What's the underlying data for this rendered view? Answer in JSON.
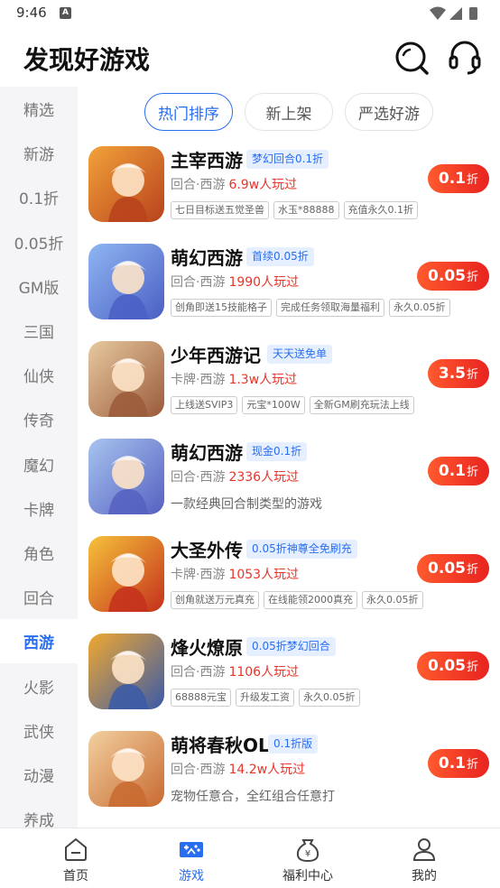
{
  "status": {
    "time": "9:46",
    "a_icon": "A"
  },
  "header": {
    "title": "发现好游戏"
  },
  "sidebar": {
    "items": [
      "精选",
      "新游",
      "0.1折",
      "0.05折",
      "GM版",
      "三国",
      "仙侠",
      "传奇",
      "魔幻",
      "卡牌",
      "角色",
      "回合",
      "西游",
      "火影",
      "武侠",
      "动漫",
      "养成"
    ],
    "active_index": 12
  },
  "tabs": [
    "热门排序",
    "新上架",
    "严选好游"
  ],
  "games": [
    {
      "name": "主宰西游",
      "badge": "梦幻回合0.1折",
      "genre": "回合·西游",
      "players": "6.9w人玩过",
      "tags": [
        "七日目标送五觉圣兽",
        "水玉*88888",
        "充值永久0.1折"
      ],
      "discount": "0.1",
      "discount_unit": "折",
      "icon_colors": [
        "#f2a23a",
        "#b8421c"
      ]
    },
    {
      "name": "萌幻西游",
      "badge": "首续0.05折",
      "genre": "回合·西游",
      "players": "1990人玩过",
      "tags": [
        "创角即送15技能格子",
        "完成任务领取海量福利",
        "永久0.05折"
      ],
      "discount": "0.05",
      "discount_unit": "折",
      "icon_colors": [
        "#8fb6f2",
        "#4b5fc4"
      ]
    },
    {
      "name": "少年西游记",
      "badge": "天天送免单",
      "genre": "卡牌·西游",
      "players": "1.3w人玩过",
      "tags": [
        "上线送SVIP3",
        "元宝*100W",
        "全新GM刷充玩法上线"
      ],
      "discount": "3.5",
      "discount_unit": "折",
      "icon_colors": [
        "#e7c9a0",
        "#9a5a3a"
      ]
    },
    {
      "name": "萌幻西游",
      "badge": "现金0.1折",
      "genre": "回合·西游",
      "players": "2336人玩过",
      "desc": "一款经典回合制类型的游戏",
      "discount": "0.1",
      "discount_unit": "折",
      "icon_colors": [
        "#a7c4f0",
        "#5660c0"
      ]
    },
    {
      "name": "大圣外传",
      "badge": "0.05折神尊全免刷充",
      "genre": "卡牌·西游",
      "players": "1053人玩过",
      "tags": [
        "创角就送万元真充",
        "在线能领2000真充",
        "永久0.05折"
      ],
      "discount": "0.05",
      "discount_unit": "折",
      "icon_colors": [
        "#f6c23a",
        "#c4301c"
      ]
    },
    {
      "name": "烽火燎原",
      "badge": "0.05折梦幻回合",
      "genre": "回合·西游",
      "players": "1106人玩过",
      "tags": [
        "68888元宝",
        "升级发工资",
        "永久0.05折"
      ],
      "discount": "0.05",
      "discount_unit": "折",
      "icon_colors": [
        "#f0a830",
        "#3a5aa8"
      ]
    },
    {
      "name": "萌将春秋OL",
      "badge": "0.1折版",
      "genre": "回合·西游",
      "players": "14.2w人玩过",
      "desc": "宠物任意合，全红组合任意打",
      "discount": "0.1",
      "discount_unit": "折",
      "icon_colors": [
        "#f2d0a0",
        "#c86a30"
      ]
    }
  ],
  "bottom_nav": [
    {
      "label": "首页",
      "icon": "home-icon",
      "active": false
    },
    {
      "label": "游戏",
      "icon": "gamepad-icon",
      "active": true
    },
    {
      "label": "福利中心",
      "icon": "money-bag-icon",
      "active": false
    },
    {
      "label": "我的",
      "icon": "user-icon",
      "active": false
    }
  ],
  "colors": {
    "accent": "#2a6ef0",
    "hot": "#e8352a",
    "discount_bg": "#ef3a22"
  }
}
